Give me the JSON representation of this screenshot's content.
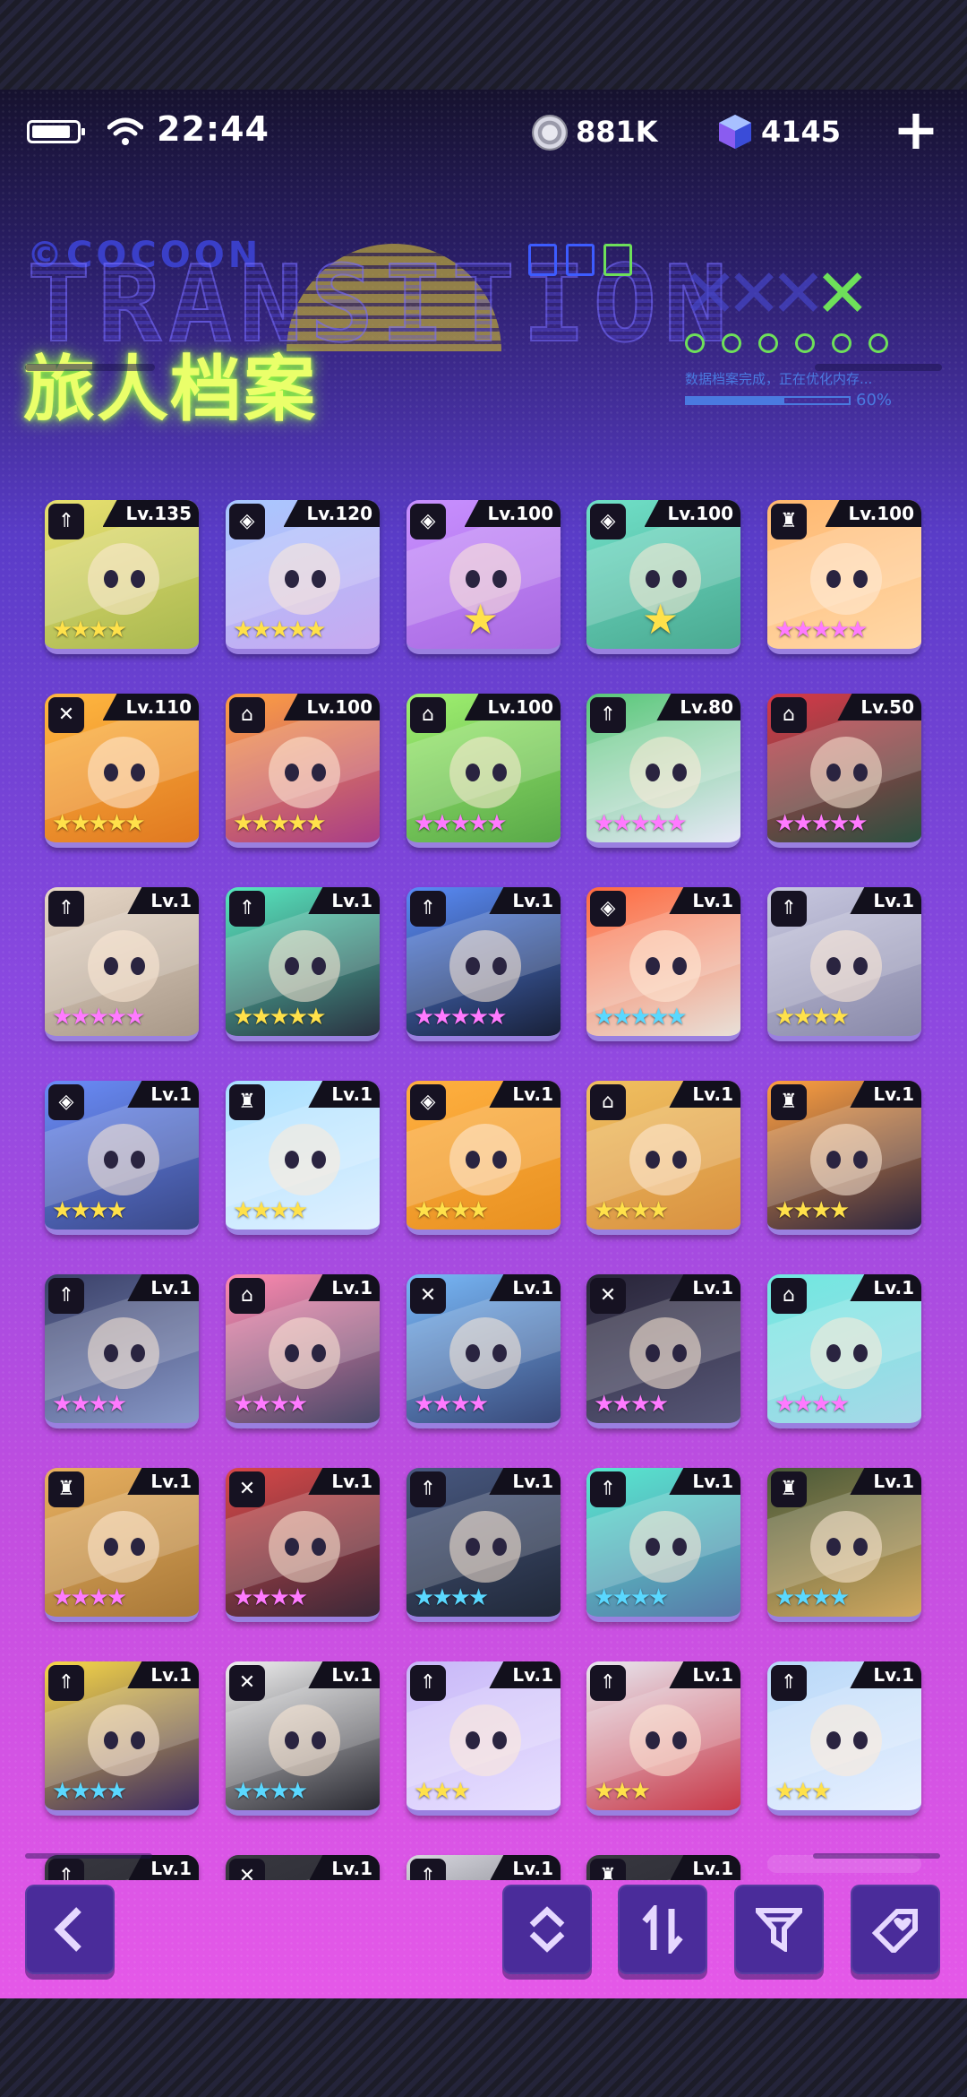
{
  "status_bar": {
    "time": "22:44",
    "coins": "881K",
    "gems": "4145"
  },
  "banner": {
    "title": "旅人档案",
    "deco_title": "TRANSITION",
    "deco_brand": "©COCOON",
    "progress_text": "数据档案完成，正在优化内存...",
    "progress_pct": "60%",
    "progress_value": 0.6
  },
  "characters": [
    {
      "level": "Lv.135",
      "stars": 4,
      "star_color": "#ffe14a",
      "class_icon": "arrow-up-icon",
      "bg": [
        "#e8e070",
        "#a8b850"
      ]
    },
    {
      "level": "Lv.120",
      "stars": 5,
      "star_color": "#ffe14a",
      "class_icon": "shield-icon",
      "bg": [
        "#a8c8ff",
        "#c8a8f0"
      ]
    },
    {
      "level": "Lv.100",
      "stars": 1,
      "star_color": "#ffe14a",
      "class_icon": "shield-icon",
      "bg": [
        "#c890ff",
        "#a868e0"
      ]
    },
    {
      "level": "Lv.100",
      "stars": 1,
      "star_color": "#ffe14a",
      "class_icon": "shield-icon",
      "bg": [
        "#70e0c8",
        "#4aa890"
      ]
    },
    {
      "level": "Lv.100",
      "stars": 5,
      "star_color": "#ff7aff",
      "class_icon": "banner-icon",
      "bg": [
        "#ffb870",
        "#ffd8a8"
      ]
    },
    {
      "level": "Lv.110",
      "stars": 5,
      "star_color": "#ffe14a",
      "class_icon": "swords-icon",
      "bg": [
        "#ffb840",
        "#e07820"
      ]
    },
    {
      "level": "Lv.100",
      "stars": 5,
      "star_color": "#ffe14a",
      "class_icon": "house-icon",
      "bg": [
        "#ffa040",
        "#a83c88"
      ]
    },
    {
      "level": "Lv.100",
      "stars": 5,
      "star_color": "#ff7aff",
      "class_icon": "house-icon",
      "bg": [
        "#a0f070",
        "#58a848"
      ]
    },
    {
      "level": "Lv.80",
      "stars": 5,
      "star_color": "#ff7aff",
      "class_icon": "arrow-up-icon",
      "bg": [
        "#58c878",
        "#e8e8f8"
      ]
    },
    {
      "level": "Lv.50",
      "stars": 5,
      "star_color": "#ff7aff",
      "class_icon": "house-icon",
      "bg": [
        "#d83848",
        "#2a5040"
      ]
    },
    {
      "level": "Lv.1",
      "stars": 5,
      "star_color": "#ff7aff",
      "class_icon": "arrow-up-icon",
      "bg": [
        "#e8d8c8",
        "#a89888"
      ]
    },
    {
      "level": "Lv.1",
      "stars": 5,
      "star_color": "#ffe14a",
      "class_icon": "arrow-up-icon",
      "bg": [
        "#58e8c0",
        "#2a3040"
      ]
    },
    {
      "level": "Lv.1",
      "stars": 5,
      "star_color": "#ff7aff",
      "class_icon": "arrow-up-icon",
      "bg": [
        "#5a8cf8",
        "#182038"
      ]
    },
    {
      "level": "Lv.1",
      "stars": 5,
      "star_color": "#5ad8ff",
      "class_icon": "shield-icon",
      "bg": [
        "#ff6a40",
        "#e8e0d8"
      ]
    },
    {
      "level": "Lv.1",
      "stars": 4,
      "star_color": "#ffe14a",
      "class_icon": "arrow-up-icon",
      "bg": [
        "#c8c8e0",
        "#8888a8"
      ]
    },
    {
      "level": "Lv.1",
      "stars": 4,
      "star_color": "#ffe14a",
      "class_icon": "shield-icon",
      "bg": [
        "#6a8cf8",
        "#3a4888"
      ]
    },
    {
      "level": "Lv.1",
      "stars": 4,
      "star_color": "#ffe14a",
      "class_icon": "banner-icon",
      "bg": [
        "#a8e0ff",
        "#e0f0ff"
      ]
    },
    {
      "level": "Lv.1",
      "stars": 4,
      "star_color": "#ffe14a",
      "class_icon": "shield-icon",
      "bg": [
        "#ffb040",
        "#e89020"
      ]
    },
    {
      "level": "Lv.1",
      "stars": 4,
      "star_color": "#ffe14a",
      "class_icon": "house-icon",
      "bg": [
        "#f0c060",
        "#d89040"
      ]
    },
    {
      "level": "Lv.1",
      "stars": 4,
      "star_color": "#ffe14a",
      "class_icon": "banner-icon",
      "bg": [
        "#ffa040",
        "#2a2440"
      ]
    },
    {
      "level": "Lv.1",
      "stars": 4,
      "star_color": "#ff7aff",
      "class_icon": "arrow-up-icon",
      "bg": [
        "#3a4068",
        "#8898c8"
      ]
    },
    {
      "level": "Lv.1",
      "stars": 4,
      "star_color": "#ff7aff",
      "class_icon": "house-icon",
      "bg": [
        "#ff8ab0",
        "#484868"
      ]
    },
    {
      "level": "Lv.1",
      "stars": 4,
      "star_color": "#ff7aff",
      "class_icon": "swords-icon",
      "bg": [
        "#78b8f8",
        "#384878"
      ]
    },
    {
      "level": "Lv.1",
      "stars": 4,
      "star_color": "#ff7aff",
      "class_icon": "swords-icon",
      "bg": [
        "#282438",
        "#585878"
      ]
    },
    {
      "level": "Lv.1",
      "stars": 4,
      "star_color": "#ff7aff",
      "class_icon": "house-icon",
      "bg": [
        "#70e8e0",
        "#a8d8e8"
      ]
    },
    {
      "level": "Lv.1",
      "stars": 4,
      "star_color": "#ff7aff",
      "class_icon": "banner-icon",
      "bg": [
        "#e8b060",
        "#a87838"
      ]
    },
    {
      "level": "Lv.1",
      "stars": 4,
      "star_color": "#ff7aff",
      "class_icon": "swords-icon",
      "bg": [
        "#d84848",
        "#3a2838"
      ]
    },
    {
      "level": "Lv.1",
      "stars": 4,
      "star_color": "#5ad8ff",
      "class_icon": "arrow-up-icon",
      "bg": [
        "#485880",
        "#202838"
      ]
    },
    {
      "level": "Lv.1",
      "stars": 4,
      "star_color": "#5ad8ff",
      "class_icon": "arrow-up-icon",
      "bg": [
        "#58e8d0",
        "#5878a8"
      ]
    },
    {
      "level": "Lv.1",
      "stars": 4,
      "star_color": "#5ad8ff",
      "class_icon": "banner-icon",
      "bg": [
        "#485838",
        "#d0a860"
      ]
    },
    {
      "level": "Lv.1",
      "stars": 4,
      "star_color": "#5ad8ff",
      "class_icon": "arrow-up-icon",
      "bg": [
        "#f8d848",
        "#3a2860"
      ]
    },
    {
      "level": "Lv.1",
      "stars": 4,
      "star_color": "#5ad8ff",
      "class_icon": "swords-icon",
      "bg": [
        "#f0f0f0",
        "#282830"
      ]
    },
    {
      "level": "Lv.1",
      "stars": 3,
      "star_color": "#ffe14a",
      "class_icon": "arrow-up-icon",
      "bg": [
        "#c8b8f8",
        "#e8e0ff"
      ]
    },
    {
      "level": "Lv.1",
      "stars": 3,
      "star_color": "#ffe14a",
      "class_icon": "arrow-up-icon",
      "bg": [
        "#e8e8f0",
        "#c83848"
      ]
    },
    {
      "level": "Lv.1",
      "stars": 3,
      "star_color": "#ffe14a",
      "class_icon": "arrow-up-icon",
      "bg": [
        "#b8d8f8",
        "#e8f0ff"
      ]
    },
    {
      "level": "Lv.1",
      "stars": 0,
      "star_color": "#ffe14a",
      "class_icon": "arrow-up-icon",
      "bg": [
        "#383840",
        "#202028"
      ]
    },
    {
      "level": "Lv.1",
      "stars": 0,
      "star_color": "#ffe14a",
      "class_icon": "swords-icon",
      "bg": [
        "#383840",
        "#202028"
      ]
    },
    {
      "level": "Lv.1",
      "stars": 0,
      "star_color": "#ffe14a",
      "class_icon": "arrow-up-icon",
      "bg": [
        "#d8d8e0",
        "#383840"
      ]
    },
    {
      "level": "Lv.1",
      "stars": 0,
      "star_color": "#ffe14a",
      "class_icon": "banner-icon",
      "bg": [
        "#383840",
        "#202028"
      ]
    }
  ],
  "toolbar": {
    "back_icon": "chevron-left-icon",
    "order_icon": "sort-order-icon",
    "sort_icon": "sort-arrows-icon",
    "filter_icon": "filter-icon",
    "favorite_icon": "heart-tag-icon"
  }
}
